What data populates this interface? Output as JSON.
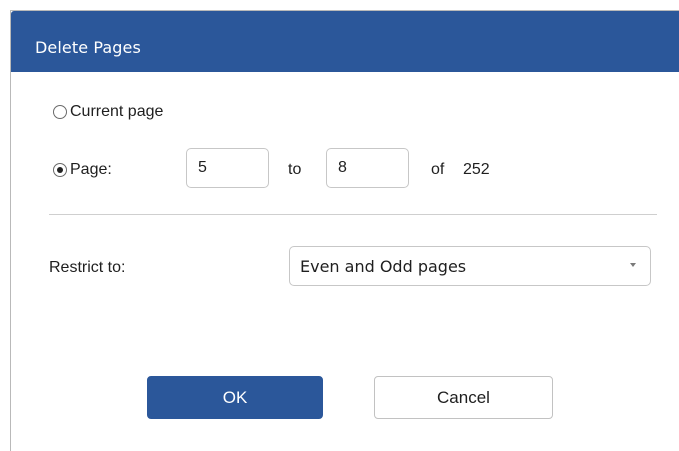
{
  "dialog": {
    "title": "Delete Pages"
  },
  "range": {
    "current_page_label": "Current page",
    "page_label": "Page:",
    "selected_option": "page",
    "from_value": "5",
    "to_label": "to",
    "to_value": "8",
    "of_label": "of",
    "total_pages": "252"
  },
  "restrict": {
    "label": "Restrict to:",
    "selected": "Even and Odd pages"
  },
  "buttons": {
    "ok_label": "OK",
    "cancel_label": "Cancel"
  },
  "colors": {
    "accent": "#2b579a"
  }
}
